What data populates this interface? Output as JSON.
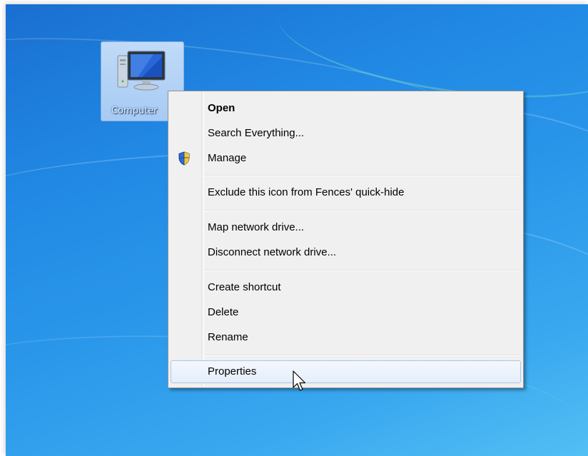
{
  "desktop": {
    "icon": {
      "label": "Computer",
      "icon": "computer-icon",
      "selected": true
    }
  },
  "context_menu": {
    "items": [
      {
        "label": "Open",
        "bold": true
      },
      {
        "label": "Search Everything..."
      },
      {
        "label": "Manage",
        "icon": "uac-shield-icon"
      },
      {
        "label": "Exclude this icon from Fences' quick-hide"
      },
      {
        "label": "Map network drive..."
      },
      {
        "label": "Disconnect network drive..."
      },
      {
        "label": "Create shortcut"
      },
      {
        "label": "Delete"
      },
      {
        "label": "Rename"
      },
      {
        "label": "Properties",
        "hovered": true
      }
    ]
  },
  "colors": {
    "wallpaper": "#2189e4",
    "menu_background": "#f0f0f0",
    "menu_hover_border": "#a8c5ea"
  },
  "cursor": {
    "icon": "arrow-pointer-icon"
  }
}
